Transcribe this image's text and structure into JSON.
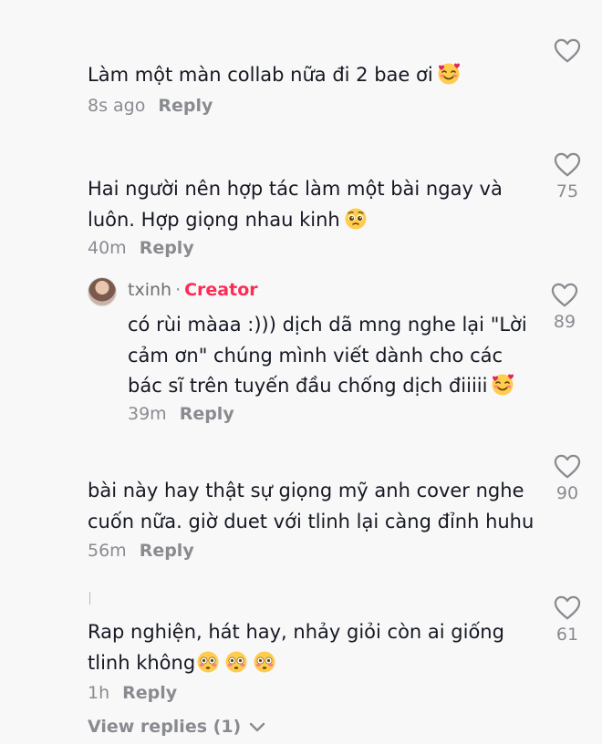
{
  "comments": [
    {
      "text_lines": [
        "Làm một màn collab nữa đi 2 bae ơi"
      ],
      "emoji_names": [
        "smiling-face-with-hearts"
      ],
      "time": "8s ago",
      "reply_label": "Reply",
      "likes": ""
    },
    {
      "text_lines": [
        "Hai người nên hợp tác làm một bài ngay và",
        "luôn. Hợp giọng nhau kinh"
      ],
      "emoji_names": [
        "pleading-face"
      ],
      "time": "40m",
      "reply_label": "Reply",
      "likes": "75"
    },
    {
      "author": "txinh",
      "author_tag": "Creator",
      "text_lines": [
        "có rùi màaa :))) dịch dã mng nghe lại \"Lời",
        "cảm ơn\" chúng mình viết dành cho các",
        "bác sĩ trên tuyến đầu chống dịch điiiii"
      ],
      "emoji_names": [
        "smiling-face-with-hearts"
      ],
      "time": "39m",
      "reply_label": "Reply",
      "likes": "89"
    },
    {
      "text_lines": [
        "bài này hay thật sự giọng mỹ anh cover nghe",
        "cuốn nữa. giờ duet với tlinh lại càng đỉnh huhu"
      ],
      "time": "56m",
      "reply_label": "Reply",
      "likes": "90"
    },
    {
      "text_lines": [
        "Rap nghiện, hát hay, nhảy giỏi còn ai giống",
        "tlinh không"
      ],
      "emoji_names": [
        "flushed-face",
        "flushed-face",
        "flushed-face"
      ],
      "time": "1h",
      "reply_label": "Reply",
      "likes": "61"
    }
  ],
  "view_replies": "View replies (1)",
  "colors": {
    "background": "#f8f8f8",
    "text": "#161823",
    "secondary": "#8a8b91",
    "creator_tag": "#fe2c55"
  },
  "icons": [
    "heart-outline-icon",
    "chevron-down-icon"
  ]
}
